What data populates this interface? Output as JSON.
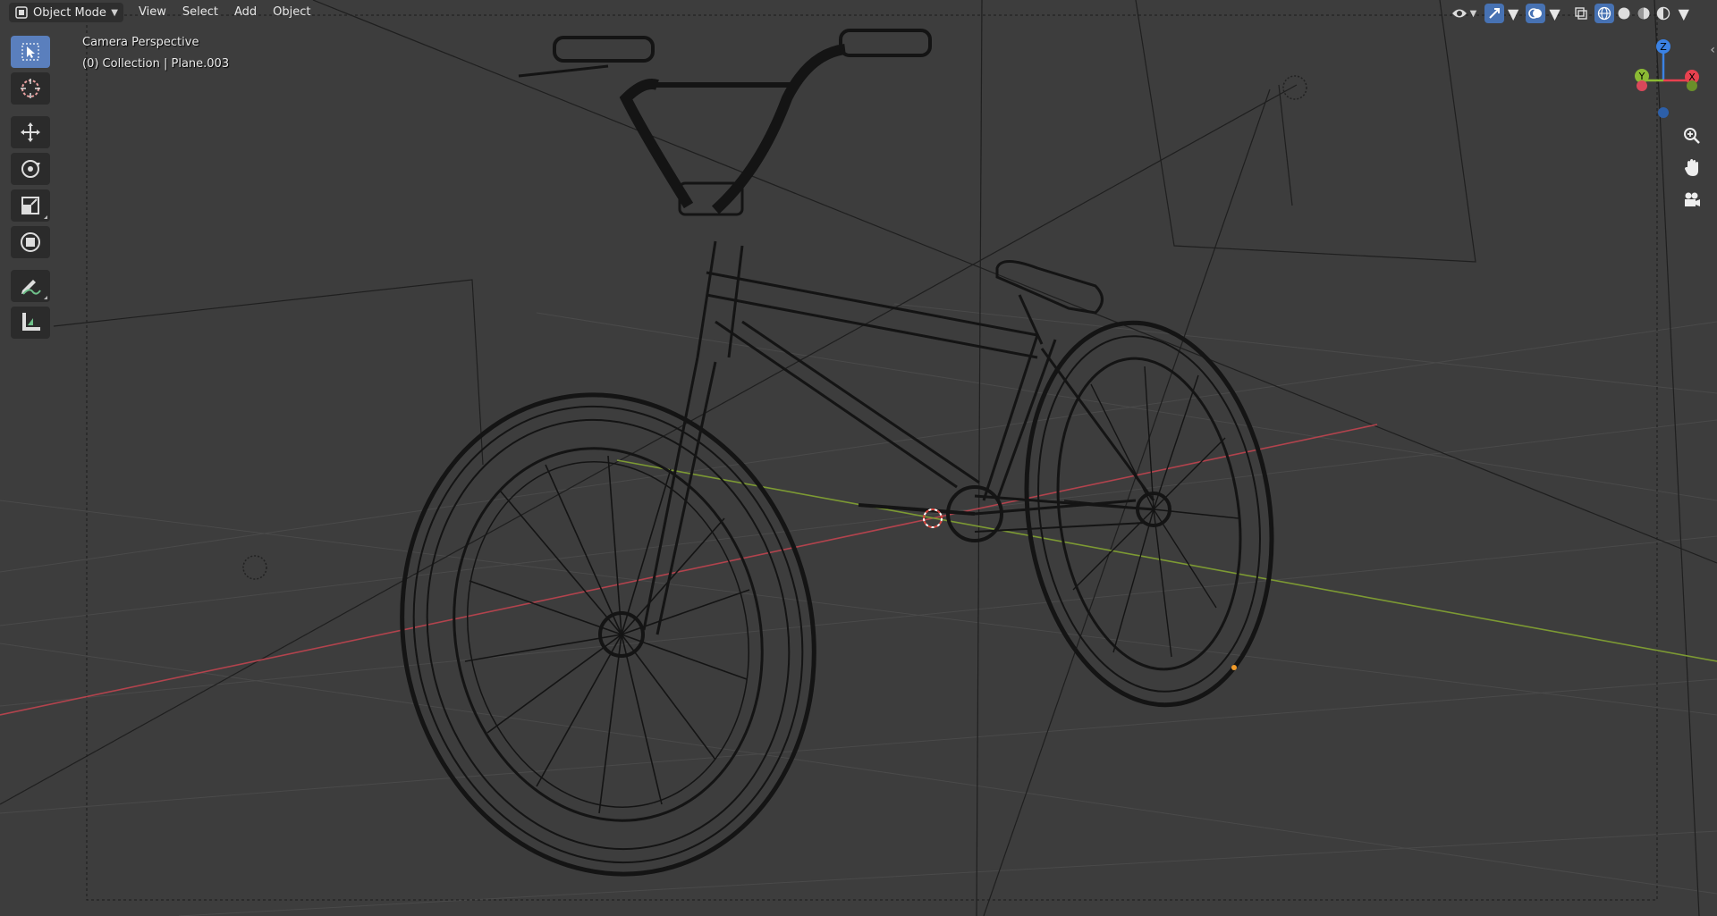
{
  "header": {
    "mode": "Object Mode",
    "menu": [
      "View",
      "Select",
      "Add",
      "Object"
    ]
  },
  "overlay": {
    "camera_label": "Camera Perspective",
    "collection_label": "(0) Collection | Plane.003"
  },
  "toolbar": {
    "tools": [
      {
        "name": "select-box",
        "icon": "cursor-arrow-icon",
        "active": true
      },
      {
        "name": "cursor",
        "icon": "3d-cursor-icon",
        "active": false
      },
      {
        "name": "move",
        "icon": "move-arrows-icon",
        "active": false
      },
      {
        "name": "rotate",
        "icon": "rotate-icon",
        "active": false
      },
      {
        "name": "scale",
        "icon": "scale-icon",
        "active": false
      },
      {
        "name": "transform",
        "icon": "transform-icon",
        "active": false
      },
      {
        "name": "annotate",
        "icon": "annotate-pencil-icon",
        "active": false
      },
      {
        "name": "measure",
        "icon": "measure-ruler-icon",
        "active": false
      }
    ]
  },
  "header_right": {
    "viewport_shading": "wireframe",
    "icons": [
      "visibility-eye-icon",
      "gizmo-icon",
      "overlay-icon",
      "xray-icon",
      "shading-wireframe-icon",
      "shading-solid-icon",
      "shading-material-icon",
      "shading-rendered-icon"
    ]
  },
  "gizmo": {
    "axes": {
      "z": "Z",
      "x": "X",
      "y": "Y"
    },
    "colors": {
      "x": "#e8414f",
      "y": "#8bba34",
      "z": "#3b82e4"
    }
  },
  "nav_buttons": [
    "zoom-icon",
    "pan-hand-icon",
    "camera-view-icon"
  ],
  "colors": {
    "background": "#3d3d3d",
    "accent": "#4772b3",
    "x_axis": "#c94b55",
    "y_axis": "#8aa43a",
    "wire": "#111111"
  }
}
